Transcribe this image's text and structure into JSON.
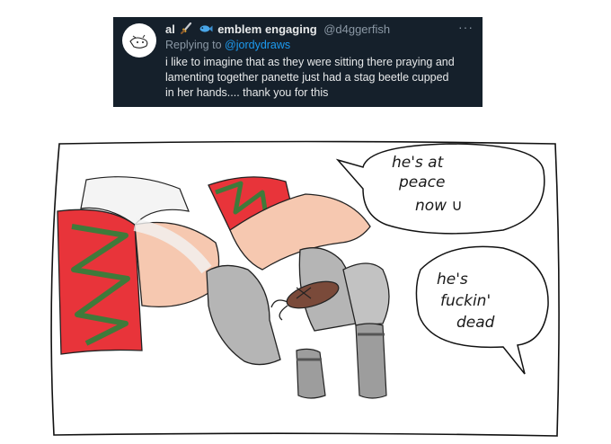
{
  "tweet": {
    "display_name": "al",
    "name_suffix": "emblem engaging",
    "handle": "@d4ggerfish",
    "more_label": "···",
    "replying_prefix": "Replying to",
    "replying_to": "@jordydraws",
    "text_lines": [
      "i like to imagine that as they were sitting there praying and",
      "lamenting together panette just had a stag beetle cupped",
      "in her hands.... thank you for this"
    ],
    "colors": {
      "background": "#15202b",
      "text": "#e7e9ea",
      "muted": "#8b98a5",
      "link": "#1d9bf0"
    },
    "icons": [
      "avatar-doodle",
      "dagger-icon",
      "fish-icon"
    ]
  },
  "comic": {
    "bubble_top_lines": [
      "he's at",
      "peace",
      "now ∪"
    ],
    "bubble_bottom_lines": [
      "he's",
      "fuckin'",
      "dead"
    ],
    "colors": {
      "sleeve_red": "#e8343a",
      "zigzag_green": "#3f7a3a",
      "skin": "#f6c8b0",
      "glove_grey": "#a8a8a8",
      "beetle": "#7a4a3a"
    }
  }
}
